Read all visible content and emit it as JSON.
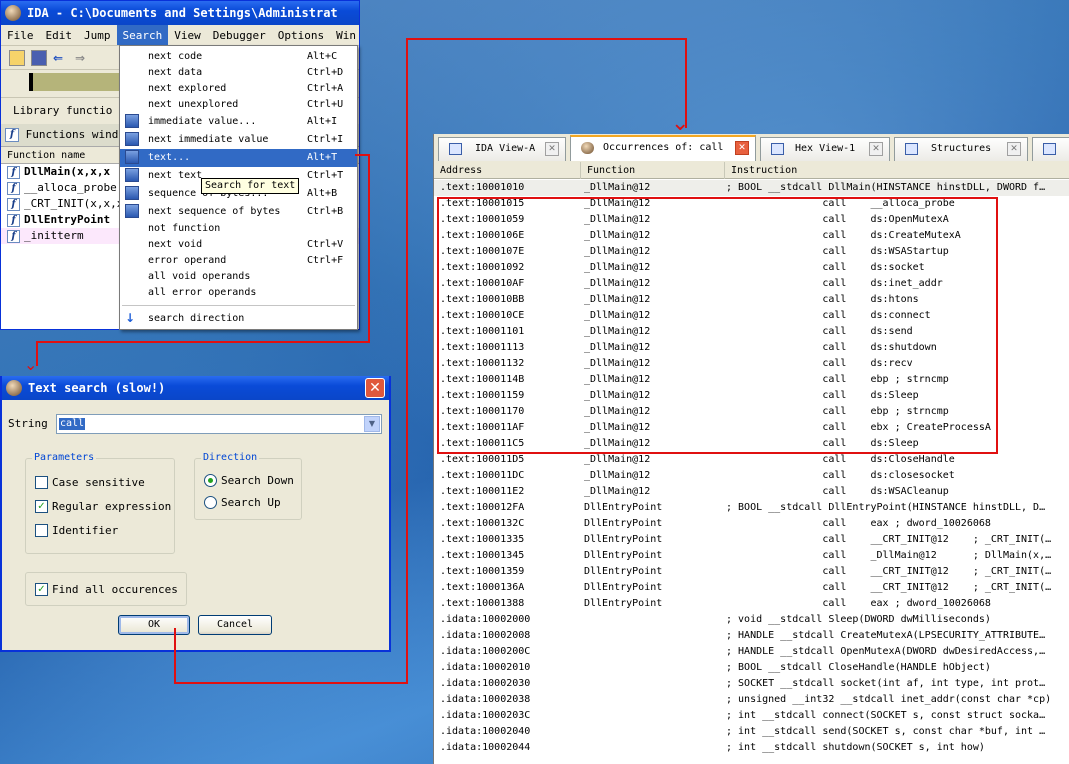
{
  "ida": {
    "title": "IDA - C:\\Documents and Settings\\Administrat",
    "menus": [
      "File",
      "Edit",
      "Jump",
      "Search",
      "View",
      "Debugger",
      "Options",
      "Win"
    ],
    "library_label": "Library functio",
    "functions_window_label": "Functions window",
    "function_name_header": "Function name",
    "functions": [
      {
        "name": "DllMain(x,x,x",
        "icon": "function-icon"
      },
      {
        "name": "__alloca_probe",
        "icon": "function-icon"
      },
      {
        "name": "_CRT_INIT(x,x,x",
        "icon": "function-icon"
      },
      {
        "name": "DllEntryPoint",
        "icon": "function-icon"
      },
      {
        "name": "_initterm",
        "icon": "function-icon"
      }
    ]
  },
  "search_menu": {
    "items": [
      {
        "label": "next code",
        "shortcut": "Alt+C"
      },
      {
        "label": "next data",
        "shortcut": "Ctrl+D"
      },
      {
        "label": "next explored",
        "shortcut": "Ctrl+A"
      },
      {
        "label": "next unexplored",
        "shortcut": "Ctrl+U"
      },
      {
        "label": "immediate value...",
        "shortcut": "Alt+I"
      },
      {
        "label": "next immediate value",
        "shortcut": "Ctrl+I"
      },
      {
        "label": "text...",
        "shortcut": "Alt+T"
      },
      {
        "label": "next text",
        "shortcut": "Ctrl+T"
      },
      {
        "label": "sequence of bytes...",
        "shortcut": "Alt+B"
      },
      {
        "label": "next sequence of bytes",
        "shortcut": "Ctrl+B"
      },
      {
        "label": "not function",
        "shortcut": ""
      },
      {
        "label": "next void",
        "shortcut": "Ctrl+V"
      },
      {
        "label": "error operand",
        "shortcut": "Ctrl+F"
      },
      {
        "label": "all void operands",
        "shortcut": ""
      },
      {
        "label": "all error operands",
        "shortcut": ""
      }
    ],
    "search_direction": "search direction",
    "tooltip": "Search for text"
  },
  "dialog": {
    "title": "Text search (slow!)",
    "string_label": "String",
    "string_value": "call",
    "parameters_label": "Parameters",
    "case_sensitive": "Case sensitive",
    "regular_expression": "Regular expression",
    "identifier": "Identifier",
    "direction_label": "Direction",
    "search_down": "Search Down",
    "search_up": "Search Up",
    "find_all": "Find all occurences",
    "ok": "OK",
    "cancel": "Cancel",
    "states": {
      "case_sensitive": false,
      "regular_expression": true,
      "identifier": false,
      "find_all": true,
      "direction": "down"
    }
  },
  "occurrences": {
    "tabs": [
      {
        "label": "IDA View-A",
        "icon": "ida-view-icon"
      },
      {
        "label": "Occurrences of: call",
        "icon": "occurrences-icon"
      },
      {
        "label": "Hex View-1",
        "icon": "hex-view-icon"
      },
      {
        "label": "Structures",
        "icon": "structures-icon"
      }
    ],
    "columns": [
      "Address",
      "Function",
      "Instruction"
    ],
    "rows": [
      [
        ".text:10001010",
        "_DllMain@12",
        "; BOOL __stdcall DllMain(HINSTANCE hinstDLL, DWORD f…"
      ],
      [
        ".text:10001015",
        "_DllMain@12",
        "                call    __alloca_probe"
      ],
      [
        ".text:10001059",
        "_DllMain@12",
        "                call    ds:OpenMutexA"
      ],
      [
        ".text:1000106E",
        "_DllMain@12",
        "                call    ds:CreateMutexA"
      ],
      [
        ".text:1000107E",
        "_DllMain@12",
        "                call    ds:WSAStartup"
      ],
      [
        ".text:10001092",
        "_DllMain@12",
        "                call    ds:socket"
      ],
      [
        ".text:100010AF",
        "_DllMain@12",
        "                call    ds:inet_addr"
      ],
      [
        ".text:100010BB",
        "_DllMain@12",
        "                call    ds:htons"
      ],
      [
        ".text:100010CE",
        "_DllMain@12",
        "                call    ds:connect"
      ],
      [
        ".text:10001101",
        "_DllMain@12",
        "                call    ds:send"
      ],
      [
        ".text:10001113",
        "_DllMain@12",
        "                call    ds:shutdown"
      ],
      [
        ".text:10001132",
        "_DllMain@12",
        "                call    ds:recv"
      ],
      [
        ".text:1000114B",
        "_DllMain@12",
        "                call    ebp ; strncmp"
      ],
      [
        ".text:10001159",
        "_DllMain@12",
        "                call    ds:Sleep"
      ],
      [
        ".text:10001170",
        "_DllMain@12",
        "                call    ebp ; strncmp"
      ],
      [
        ".text:100011AF",
        "_DllMain@12",
        "                call    ebx ; CreateProcessA"
      ],
      [
        ".text:100011C5",
        "_DllMain@12",
        "                call    ds:Sleep"
      ],
      [
        ".text:100011D5",
        "_DllMain@12",
        "                call    ds:CloseHandle"
      ],
      [
        ".text:100011DC",
        "_DllMain@12",
        "                call    ds:closesocket"
      ],
      [
        ".text:100011E2",
        "_DllMain@12",
        "                call    ds:WSACleanup"
      ],
      [
        ".text:100012FA",
        "DllEntryPoint",
        "; BOOL __stdcall DllEntryPoint(HINSTANCE hinstDLL, D…"
      ],
      [
        ".text:1000132C",
        "DllEntryPoint",
        "                call    eax ; dword_10026068"
      ],
      [
        ".text:10001335",
        "DllEntryPoint",
        "                call    __CRT_INIT@12    ; _CRT_INIT(…"
      ],
      [
        ".text:10001345",
        "DllEntryPoint",
        "                call    _DllMain@12      ; DllMain(x,…"
      ],
      [
        ".text:10001359",
        "DllEntryPoint",
        "                call    __CRT_INIT@12    ; _CRT_INIT(…"
      ],
      [
        ".text:1000136A",
        "DllEntryPoint",
        "                call    __CRT_INIT@12    ; _CRT_INIT(…"
      ],
      [
        ".text:10001388",
        "DllEntryPoint",
        "                call    eax ; dword_10026068"
      ],
      [
        ".idata:10002000",
        "",
        "; void __stdcall Sleep(DWORD dwMilliseconds)"
      ],
      [
        ".idata:10002008",
        "",
        "; HANDLE __stdcall CreateMutexA(LPSECURITY_ATTRIBUTE…"
      ],
      [
        ".idata:1000200C",
        "",
        "; HANDLE __stdcall OpenMutexA(DWORD dwDesiredAccess,…"
      ],
      [
        ".idata:10002010",
        "",
        "; BOOL __stdcall CloseHandle(HANDLE hObject)"
      ],
      [
        ".idata:10002030",
        "",
        "; SOCKET __stdcall socket(int af, int type, int prot…"
      ],
      [
        ".idata:10002038",
        "",
        "; unsigned __int32 __stdcall inet_addr(const char *cp)"
      ],
      [
        ".idata:1000203C",
        "",
        "; int __stdcall connect(SOCKET s, const struct socka…"
      ],
      [
        ".idata:10002040",
        "",
        "; int __stdcall send(SOCKET s, const char *buf, int …"
      ],
      [
        ".idata:10002044",
        "",
        "; int __stdcall shutdown(SOCKET s, int how)"
      ]
    ]
  },
  "colors": {
    "highlight": "#316ac5",
    "annotation": "#e01010",
    "xp_title": "#0a4bd8"
  }
}
